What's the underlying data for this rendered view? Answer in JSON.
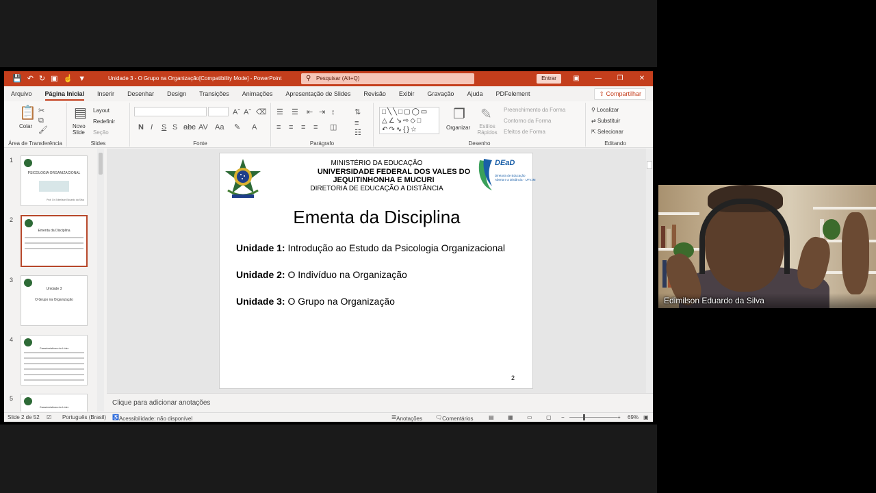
{
  "window": {
    "title": "Unidade 3 - O Grupo na Organização[Compatibility Mode]  -  PowerPoint",
    "search_placeholder": "Pesquisar (Alt+Q)",
    "signin_label": "Entrar",
    "accent": "#c43e1c"
  },
  "tabs": [
    "Arquivo",
    "Página Inicial",
    "Inserir",
    "Desenhar",
    "Design",
    "Transições",
    "Animações",
    "Apresentação de Slides",
    "Revisão",
    "Exibir",
    "Gravação",
    "Ajuda",
    "PDFelement"
  ],
  "share_label": "Compartilhar",
  "ribbon": {
    "clipboard": {
      "label": "Área de Transferência",
      "paste": "Colar"
    },
    "slides": {
      "label": "Slides",
      "new_slide": "Novo Slide",
      "layout": "Layout",
      "reset": "Redefinir",
      "section": "Seção"
    },
    "font": {
      "label": "Fonte"
    },
    "paragraph": {
      "label": "Parágrafo"
    },
    "drawing": {
      "label": "Desenho",
      "arrange": "Organizar",
      "quick_styles": "Estilos Rápidos",
      "shape_fill": "Preenchimento da Forma",
      "shape_outline": "Contorno da Forma",
      "shape_effects": "Efeitos de Forma"
    },
    "editing": {
      "label": "Editando",
      "find": "Localizar",
      "replace": "Substituir",
      "select": "Selecionar"
    }
  },
  "thumbnails": [
    {
      "number": "1",
      "title": "PSICOLOGIA ORGANIZACIONAL",
      "caption": "Prof. Dr. Edimilson Eduardo da Silva"
    },
    {
      "number": "2",
      "title": "Ementa da Disciplina",
      "caption": ""
    },
    {
      "number": "3",
      "title": "Unidade 3",
      "caption": "O Grupo na Organização"
    },
    {
      "number": "4",
      "title": "Características do Líder",
      "caption": ""
    },
    {
      "number": "5",
      "title": "Características do Líder",
      "caption": ""
    }
  ],
  "slide": {
    "header_line1": "MINISTÉRIO DA EDUCAÇÃO",
    "header_line2": "UNIVERSIDADE FEDERAL DOS VALES DO",
    "header_line3": "JEQUITINHONHA E MUCURI",
    "header_line4": "DIRETORIA DE EDUCAÇÃO A DISTÂNCIA",
    "logo_text": "DEaD",
    "logo_sub1": "Diretoria de Educação",
    "logo_sub2": "Aberta e a Distância - UFVJM",
    "title": "Ementa da Disciplina",
    "units": [
      {
        "label": "Unidade 1:",
        "text": "Introdução ao Estudo da Psicologia Organizacional"
      },
      {
        "label": "Unidade 2:",
        "text": "O Indivíduo na Organização"
      },
      {
        "label": "Unidade 3:",
        "text": "O Grupo na Organização"
      }
    ],
    "page_number": "2"
  },
  "notes_placeholder": "Clique para adicionar anotações",
  "status": {
    "slide_counter": "Slide 2 de 52",
    "language": "Português (Brasil)",
    "accessibility": "Acessibilidade: não disponível",
    "notes": "Anotações",
    "comments": "Comentários",
    "zoom": "69%"
  },
  "webcam": {
    "participant_name": "Edimilson Eduardo da Silva"
  }
}
